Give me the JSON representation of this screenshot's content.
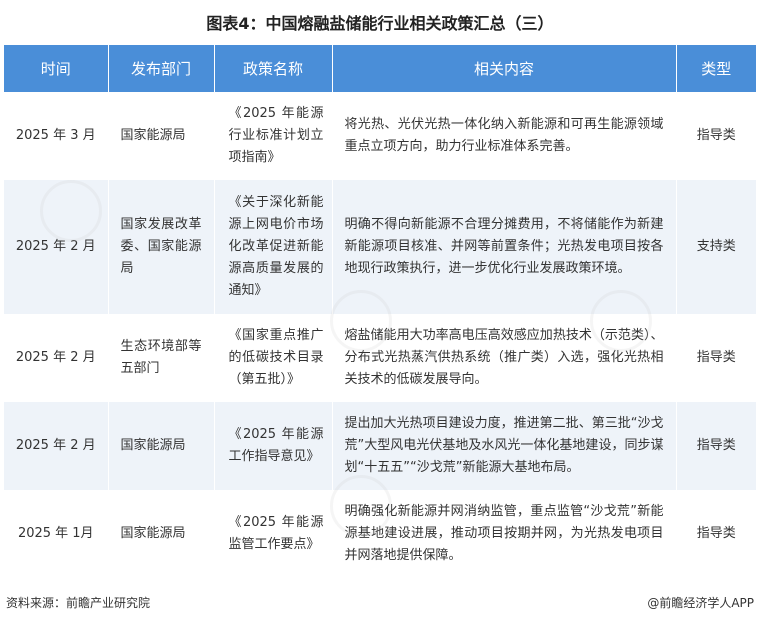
{
  "title": "图表4：中国熔融盐储能行业相关政策汇总（三）",
  "table": {
    "headers": [
      "时间",
      "发布部门",
      "政策名称",
      "相关内容",
      "类型"
    ],
    "rows": [
      {
        "time": "2025 年 3 月",
        "dept": "国家能源局",
        "policy": "《2025 年能源行业标准计划立项指南》",
        "content": "将光热、光伏光热一体化纳入新能源和可再生能源领域重点立项方向，助力行业标准体系完善。",
        "type": "指导类"
      },
      {
        "time": "2025 年 2 月",
        "dept": "国家发展改革委、国家能源局",
        "policy": "《关于深化新能源上网电价市场化改革促进新能源高质量发展的通知》",
        "content": "明确不得向新能源不合理分摊费用，不将储能作为新建新能源项目核准、并网等前置条件；光热发电项目按各地现行政策执行，进一步优化行业发展政策环境。",
        "type": "支持类"
      },
      {
        "time": "2025 年 2 月",
        "dept": "生态环境部等五部门",
        "policy": "《国家重点推广的低碳技术目录（第五批）》",
        "content": "熔盐储能用大功率高电压高效感应加热技术（示范类）、分布式光热蒸汽供热系统（推广类）入选，强化光热相关技术的低碳发展导向。",
        "type": "指导类"
      },
      {
        "time": "2025 年 2 月",
        "dept": "国家能源局",
        "policy": "《2025 年能源工作指导意见》",
        "content": "提出加大光热项目建设力度，推进第二批、第三批“沙戈荒”大型风电光伏基地及水风光一体化基地建设，同步谋划“十五五”“沙戈荒”新能源大基地布局。",
        "type": "指导类"
      },
      {
        "time": "2025 年 1月",
        "dept": "国家能源局",
        "policy": "《2025 年能源监管工作要点》",
        "content": "明确强化新能源并网消纳监管，重点监管“沙戈荒”新能源基地建设进展，推动项目按期并网，为光热发电项目并网落地提供保障。",
        "type": "指导类"
      }
    ]
  },
  "footer": {
    "source": "资料来源：前瞻产业研究院",
    "brand": "@前瞻经济学人APP"
  }
}
